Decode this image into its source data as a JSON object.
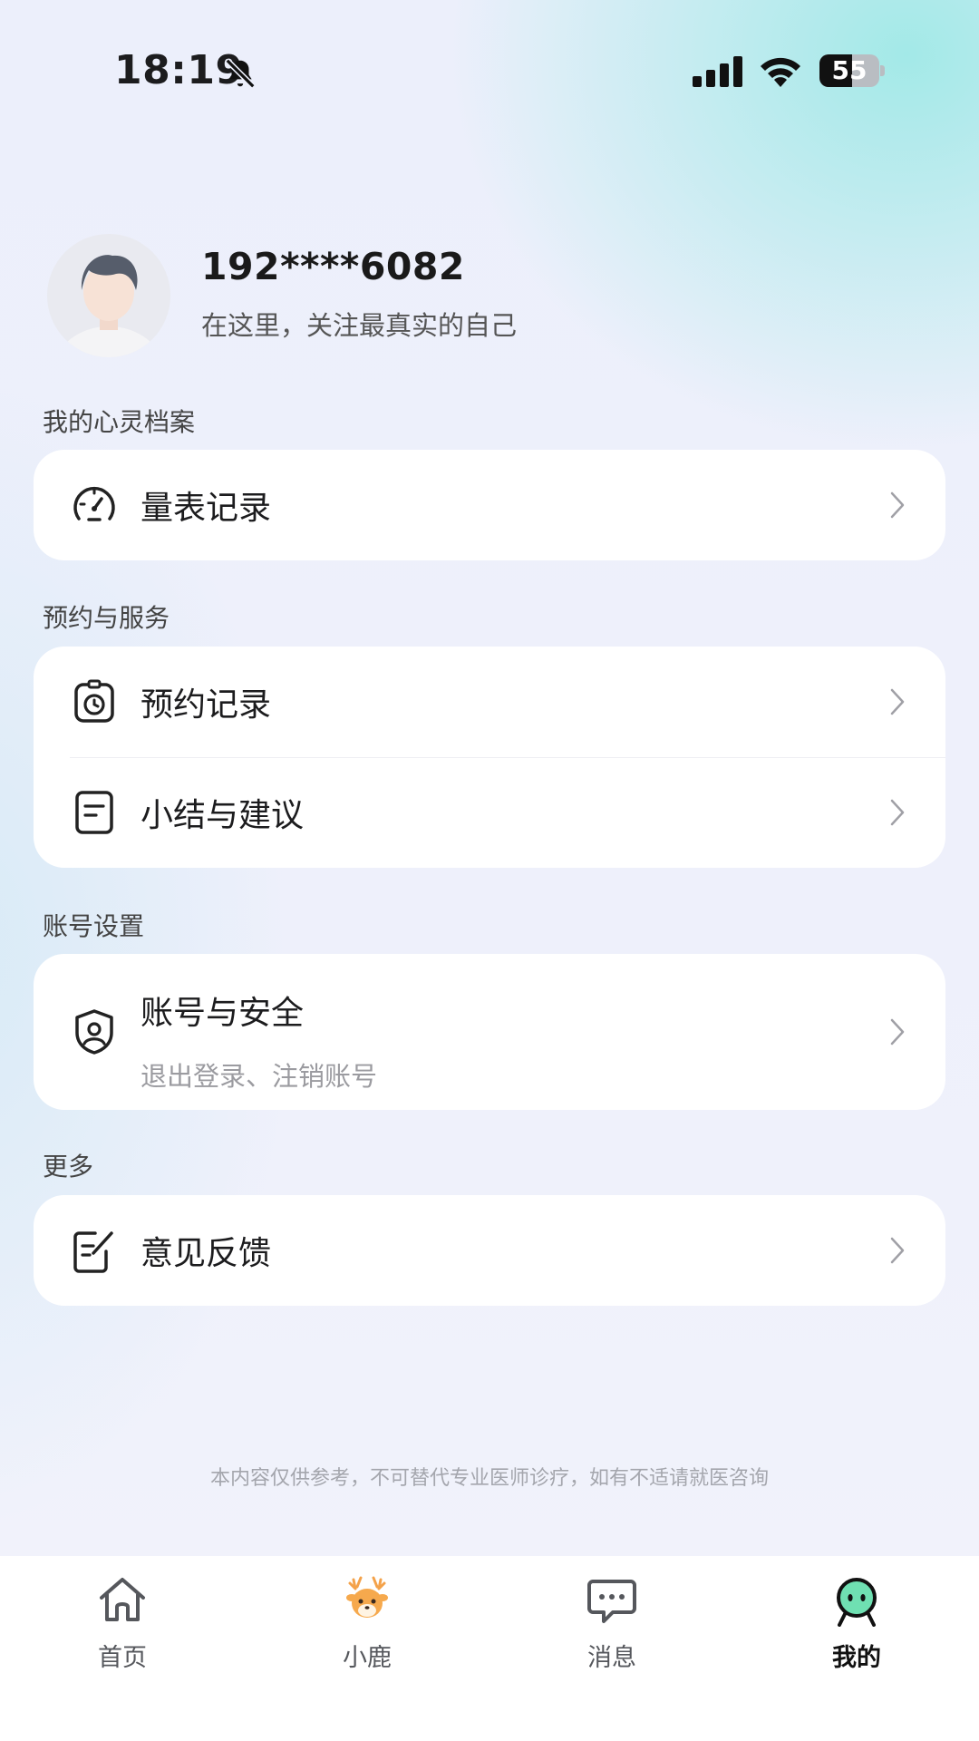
{
  "status_bar": {
    "time": "18:19",
    "battery": "55",
    "battery_level": 0.55
  },
  "profile": {
    "name": "192****6082",
    "motto": "在这里，关注最真实的自己"
  },
  "sections": [
    {
      "title": "我的心灵档案",
      "items": [
        {
          "label": "量表记录",
          "icon": "gauge-icon"
        }
      ]
    },
    {
      "title": "预约与服务",
      "items": [
        {
          "label": "预约记录",
          "icon": "appointment-timer-icon"
        },
        {
          "label": "小结与建议",
          "icon": "document-icon"
        }
      ]
    },
    {
      "title": "账号设置",
      "items": [
        {
          "label": "账号与安全",
          "sublabel": "退出登录、注销账号",
          "icon": "shield-user-icon"
        }
      ]
    },
    {
      "title": "更多",
      "items": [
        {
          "label": "意见反馈",
          "icon": "feedback-edit-icon"
        }
      ]
    }
  ],
  "disclaimer": "本内容仅供参考，不可替代专业医师诊疗，如有不适请就医咨询",
  "tab_bar": {
    "active": "我的",
    "items": [
      {
        "label": "首页",
        "icon": "home-icon"
      },
      {
        "label": "小鹿",
        "icon": "deer-mascot-icon"
      },
      {
        "label": "消息",
        "icon": "message-icon"
      },
      {
        "label": "我的",
        "icon": "profile-mascot-icon"
      }
    ]
  },
  "colors": {
    "mascot_green": "#6fe0b2",
    "mascot_orange": "#f4a24a",
    "text_primary": "#1c1c1e",
    "text_secondary": "#9b9ba0"
  }
}
